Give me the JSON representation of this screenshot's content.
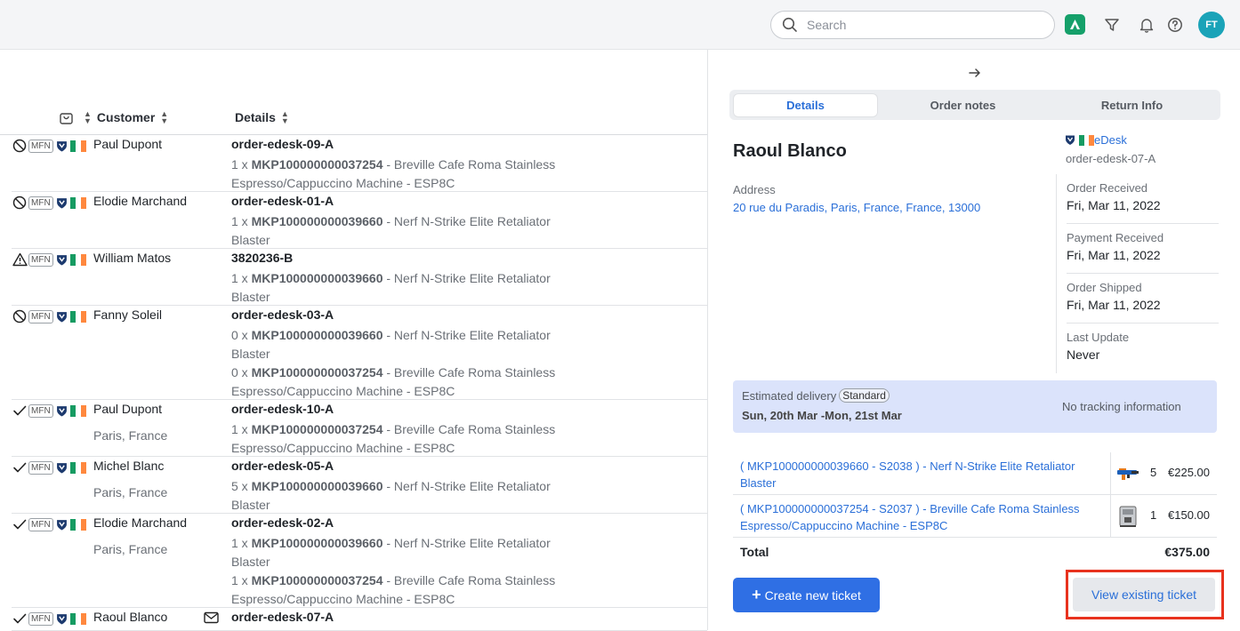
{
  "topbar": {
    "search_placeholder": "Search",
    "icons": [
      "app-icon",
      "filter-icon",
      "bell-icon",
      "help-icon"
    ],
    "avatar_initials": "FT",
    "avatar_color": "#1aa3b8"
  },
  "table": {
    "headers": {
      "customer": "Customer",
      "details": "Details"
    },
    "rows": [
      {
        "status": "blocked",
        "channel": "MFN",
        "customer": "Paul Dupont",
        "location": "",
        "order": "order-edesk-09-A",
        "lines": [
          {
            "qty": "1 x",
            "sku": "MKP100000000037254",
            "desc": " - Breville Cafe Roma Stainless",
            "desc2": "Espresso/Cappuccino Machine - ESP8C"
          }
        ]
      },
      {
        "status": "blocked",
        "channel": "MFN",
        "customer": "Elodie Marchand",
        "location": "",
        "order": "order-edesk-01-A",
        "lines": [
          {
            "qty": "1 x",
            "sku": "MKP100000000039660",
            "desc": " - Nerf N-Strike Elite Retaliator",
            "desc2": "Blaster"
          }
        ]
      },
      {
        "status": "warning",
        "channel": "MFN",
        "customer": "William Matos",
        "location": "",
        "order": "3820236-B",
        "lines": [
          {
            "qty": "1 x",
            "sku": "MKP100000000039660",
            "desc": " - Nerf N-Strike Elite Retaliator",
            "desc2": "Blaster"
          }
        ]
      },
      {
        "status": "blocked",
        "channel": "MFN",
        "customer": "Fanny Soleil",
        "location": "",
        "order": "order-edesk-03-A",
        "lines": [
          {
            "qty": "0 x",
            "sku": "MKP100000000039660",
            "desc": " - Nerf N-Strike Elite Retaliator",
            "desc2": "Blaster"
          },
          {
            "qty": "0 x",
            "sku": "MKP100000000037254",
            "desc": " - Breville Cafe Roma Stainless",
            "desc2": "Espresso/Cappuccino Machine - ESP8C"
          }
        ]
      },
      {
        "status": "done",
        "channel": "MFN",
        "customer": "Paul Dupont",
        "location": "Paris, France",
        "order": "order-edesk-10-A",
        "lines": [
          {
            "qty": "1 x",
            "sku": "MKP100000000037254",
            "desc": " - Breville Cafe Roma Stainless",
            "desc2": "Espresso/Cappuccino Machine - ESP8C"
          }
        ]
      },
      {
        "status": "done",
        "channel": "MFN",
        "customer": "Michel Blanc",
        "location": "Paris, France",
        "order": "order-edesk-05-A",
        "lines": [
          {
            "qty": "5 x",
            "sku": "MKP100000000039660",
            "desc": " - Nerf N-Strike Elite Retaliator",
            "desc2": "Blaster"
          }
        ]
      },
      {
        "status": "done",
        "channel": "MFN",
        "customer": "Elodie Marchand",
        "location": "Paris, France",
        "order": "order-edesk-02-A",
        "lines": [
          {
            "qty": "1 x",
            "sku": "MKP100000000039660",
            "desc": " - Nerf N-Strike Elite Retaliator",
            "desc2": "Blaster"
          },
          {
            "qty": "1 x",
            "sku": "MKP100000000037254",
            "desc": " - Breville Cafe Roma Stainless",
            "desc2": "Espresso/Cappuccino Machine - ESP8C"
          }
        ]
      },
      {
        "status": "done",
        "channel": "MFN",
        "customer": "Raoul Blanco",
        "location": "",
        "order": "order-edesk-07-A",
        "has_mail": true,
        "lines": []
      }
    ]
  },
  "panel": {
    "tabs": [
      "Details",
      "Order notes",
      "Return Info"
    ],
    "customer_name": "Raoul Blanco",
    "channel_name": "eDesk",
    "channel_order": "order-edesk-07-A",
    "address_label": "Address",
    "address": "20 rue du Paradis, Paris, France, France, 13000",
    "dates": [
      {
        "label": "Order Received",
        "value": "Fri, Mar 11, 2022"
      },
      {
        "label": "Payment Received",
        "value": "Fri, Mar 11, 2022"
      },
      {
        "label": "Order Shipped",
        "value": "Fri, Mar 11, 2022"
      },
      {
        "label": "Last Update",
        "value": "Never"
      }
    ],
    "delivery": {
      "label": "Estimated delivery",
      "badge": "Standard",
      "range": "Sun, 20th Mar -Mon, 21st Mar",
      "tracking": "No tracking information"
    },
    "items": [
      {
        "name": "( MKP100000000039660 - S2038 ) - Nerf N-Strike Elite Retaliator Blaster",
        "qty": "5",
        "price": "€225.00",
        "thumb": "blaster-thumbnail"
      },
      {
        "name": "( MKP100000000037254 - S2037 ) - Breville Cafe Roma Stainless Espresso/Cappuccino Machine - ESP8C",
        "qty": "1",
        "price": "€150.00",
        "thumb": "espresso-machine-thumbnail"
      }
    ],
    "total_label": "Total",
    "total_value": "€375.00",
    "create_button": "Create new ticket",
    "view_button": "View existing ticket",
    "highlight_color": "#e8321e"
  }
}
